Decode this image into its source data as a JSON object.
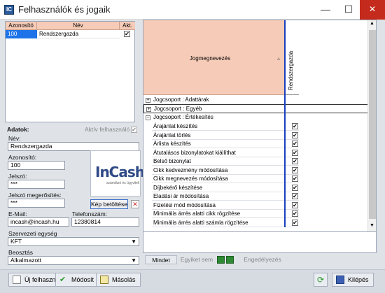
{
  "window": {
    "title": "Felhasználók és jogaik",
    "app_icon": "IC",
    "minimize": "—",
    "maximize": "☐",
    "close": "✕"
  },
  "user_grid": {
    "headers": [
      "Azonosító",
      "Név",
      "Akt."
    ],
    "rows": [
      {
        "id": "100",
        "name": "Rendszergazda",
        "active": "✔"
      }
    ]
  },
  "form": {
    "section_label": "Adatok:",
    "active_label": "Aktív felhasználó",
    "active_checked": "✔",
    "name_label": "Név:",
    "name_value": "Rendszergazda",
    "id_label": "Azonosító:",
    "id_value": "100",
    "password_label": "Jelszó:",
    "password_value": "***",
    "password_confirm_label": "Jelszó megerősítés:",
    "password_confirm_value": "***",
    "logo_text": "InCash",
    "logo_subtext": "számlázó és ügyviteli",
    "load_image_button": "Kép betöltése",
    "delete_image_icon": "✕",
    "email_label": "E-Mail:",
    "email_value": "incash@incash.hu",
    "phone_label": "Telefonszám:",
    "phone_value": "12380814",
    "org_unit_label": "Szervezeti egység",
    "org_unit_value": "KFT",
    "position_label": "Beosztás",
    "position_value": "Alkalmazott"
  },
  "permissions": {
    "name_header": "Jogmegnevezés",
    "user_column": "Rendszergazda",
    "groups_collapsed": [
      "Jogcsoport : Adattárak",
      "Jogcsoport : Egyéb"
    ],
    "expanded_group": "Jogcsoport : Értékesítés",
    "rows": [
      {
        "name": "Árajánlat készítés",
        "checked": "✔"
      },
      {
        "name": "Árajánlat törlés",
        "checked": "✔"
      },
      {
        "name": "Árlista készítés",
        "checked": "✔"
      },
      {
        "name": "Átutalásos bizonylatokat kiállíthat",
        "checked": "✔"
      },
      {
        "name": "Belső bizonylat",
        "checked": "✔"
      },
      {
        "name": "Cikk kedvezmény módosítása",
        "checked": "✔"
      },
      {
        "name": "Cikk megnevezés módosítása",
        "checked": "✔"
      },
      {
        "name": "Díjbekérő készítése",
        "checked": "✔"
      },
      {
        "name": "Eladási ár módosítása",
        "checked": "✔"
      },
      {
        "name": "Fizetési mód módosítása",
        "checked": "✔"
      },
      {
        "name": "Minimális árrés alatti cikk rögzítése",
        "checked": "✔"
      },
      {
        "name": "Minimális árrés alatti számla rögzítése",
        "checked": "✔"
      }
    ],
    "actions": {
      "all": "Mindet",
      "none": "Egyiket sem",
      "allow": "Engedélyezés"
    }
  },
  "footer": {
    "new_user": "Új felhasználó",
    "modify": "Módosít",
    "copy": "Másolás",
    "exit": "Kilépés"
  },
  "colors": {
    "header_bg": "#f6cbb7",
    "selection": "#1e73e8",
    "accent_line": "#1a3fbf"
  }
}
